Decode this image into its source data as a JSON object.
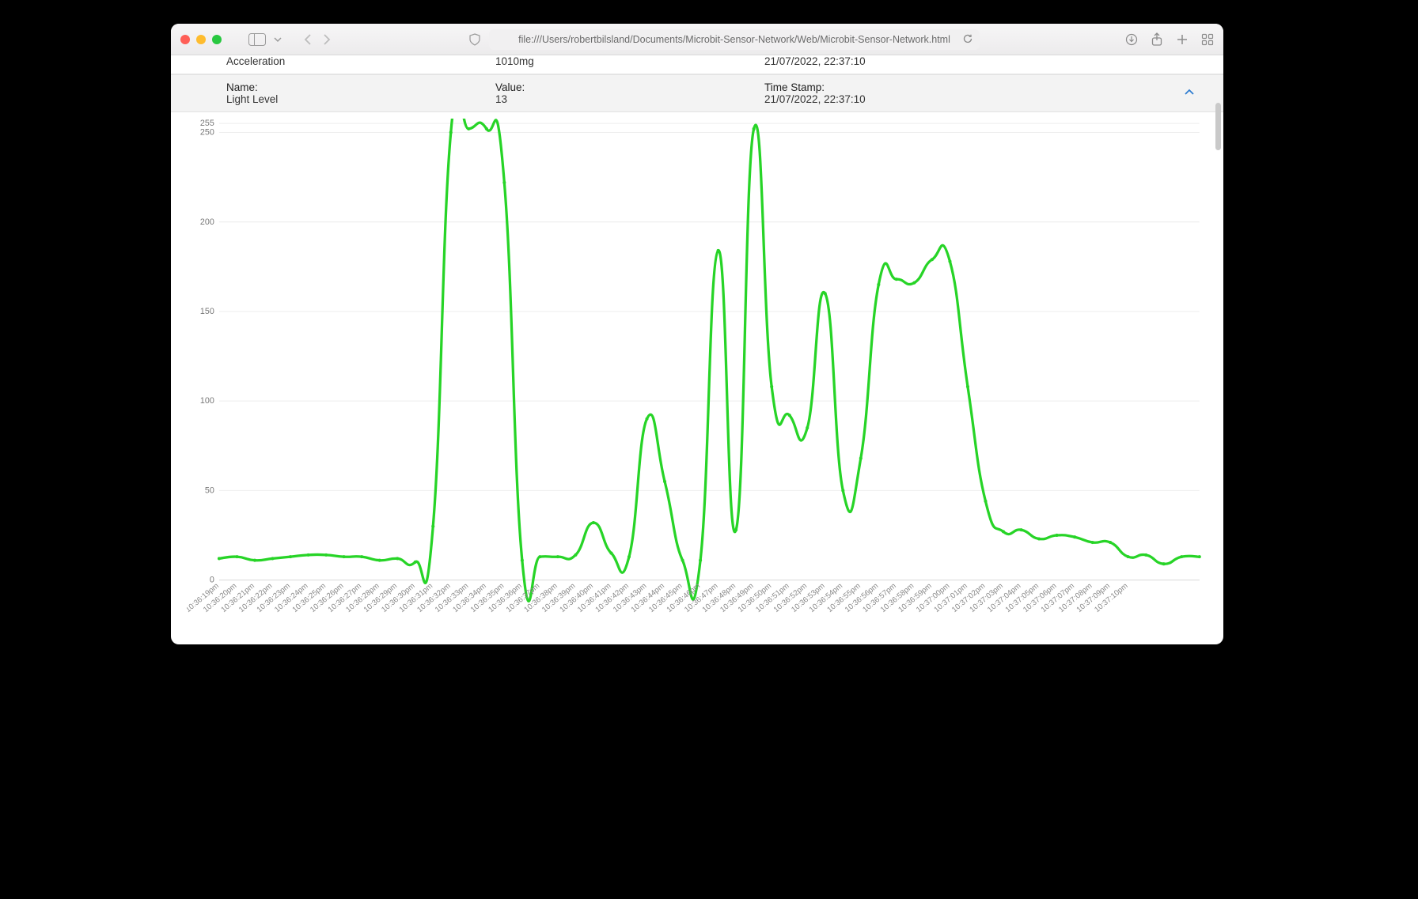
{
  "browser": {
    "url": "file:///Users/robertbilsland/Documents/Microbit-Sensor-Network/Web/Microbit-Sensor-Network.html"
  },
  "rows": {
    "acceleration": {
      "name": "Acceleration",
      "value": "1010mg",
      "timestamp": "21/07/2022, 22:37:10"
    },
    "light": {
      "name_label": "Name:",
      "value_label": "Value:",
      "timestamp_label": "Time Stamp:",
      "name": "Light Level",
      "value": "13",
      "timestamp": "21/07/2022, 22:37:10"
    }
  },
  "chart_data": {
    "type": "line",
    "title": "",
    "xlabel": "",
    "ylabel": "",
    "ylim": [
      0,
      255
    ],
    "y_ticks": [
      0,
      50,
      100,
      150,
      200,
      250,
      255
    ],
    "color": "#27d427",
    "categories": [
      "10:36:19pm",
      "10:36:20pm",
      "10:36:21pm",
      "10:36:22pm",
      "10:36:23pm",
      "10:36:24pm",
      "10:36:25pm",
      "10:36:26pm",
      "10:36:27pm",
      "10:36:28pm",
      "10:36:29pm",
      "10:36:30pm",
      "10:36:31pm",
      "10:36:32pm",
      "10:36:33pm",
      "10:36:34pm",
      "10:36:35pm",
      "10:36:36pm",
      "10:36:37pm",
      "10:36:38pm",
      "10:36:39pm",
      "10:36:40pm",
      "10:36:41pm",
      "10:36:42pm",
      "10:36:43pm",
      "10:36:44pm",
      "10:36:45pm",
      "10:36:46pm",
      "10:36:47pm",
      "10:36:48pm",
      "10:36:49pm",
      "10:36:50pm",
      "10:36:51pm",
      "10:36:52pm",
      "10:36:53pm",
      "10:36:54pm",
      "10:36:55pm",
      "10:36:56pm",
      "10:36:57pm",
      "10:36:58pm",
      "10:36:59pm",
      "10:37:00pm",
      "10:37:01pm",
      "10:37:02pm",
      "10:37:03pm",
      "10:37:04pm",
      "10:37:05pm",
      "10:37:06pm",
      "10:37:07pm",
      "10:37:08pm",
      "10:37:09pm",
      "10:37:10pm"
    ],
    "values": [
      12,
      13,
      11,
      12,
      13,
      14,
      14,
      13,
      13,
      11,
      12,
      10,
      30,
      250,
      252,
      252,
      222,
      11,
      13,
      13,
      14,
      32,
      15,
      13,
      90,
      55,
      11,
      11,
      184,
      28,
      252,
      108,
      92,
      85,
      160,
      50,
      68,
      165,
      168,
      166,
      179,
      178,
      108,
      44,
      27,
      28,
      23,
      25,
      24,
      21,
      21,
      13,
      14,
      9,
      13,
      13
    ]
  }
}
